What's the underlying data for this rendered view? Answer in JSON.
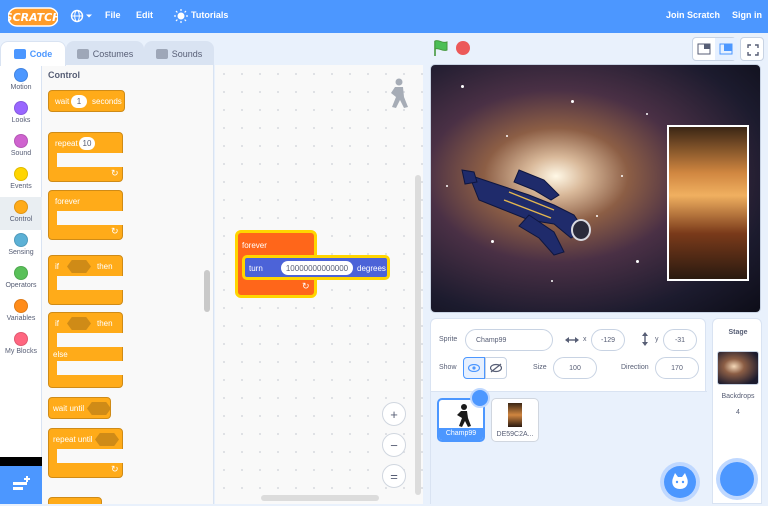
{
  "menubar": {
    "logo_text": "SCRATCH",
    "file": "File",
    "edit": "Edit",
    "tutorials": "Tutorials",
    "join": "Join Scratch",
    "signin": "Sign in"
  },
  "tabs": {
    "code": "Code",
    "costumes": "Costumes",
    "sounds": "Sounds"
  },
  "categories": [
    {
      "label": "Motion",
      "color": "#4c97ff"
    },
    {
      "label": "Looks",
      "color": "#9966ff"
    },
    {
      "label": "Sound",
      "color": "#cf63cf"
    },
    {
      "label": "Events",
      "color": "#ffd500"
    },
    {
      "label": "Control",
      "color": "#ffab19"
    },
    {
      "label": "Sensing",
      "color": "#5cb1d6"
    },
    {
      "label": "Operators",
      "color": "#59c059"
    },
    {
      "label": "Variables",
      "color": "#ff8c1a"
    },
    {
      "label": "My Blocks",
      "color": "#ff6680"
    }
  ],
  "palette": {
    "title": "Control",
    "wait": {
      "label": "wait",
      "value": "1",
      "unit": "seconds"
    },
    "repeat": {
      "label": "repeat",
      "value": "10"
    },
    "forever": "forever",
    "if_then": {
      "if": "if",
      "then": "then"
    },
    "if_else": {
      "if": "if",
      "then": "then",
      "else": "else"
    },
    "wait_until": "wait until",
    "repeat_until": "repeat until"
  },
  "script": {
    "forever": "forever",
    "turn": "turn",
    "turn_value": "10000000000000",
    "degrees": "degrees"
  },
  "zoom": {
    "in": "+",
    "out": "−",
    "reset": "="
  },
  "sprite_info": {
    "sprite_label": "Sprite",
    "sprite_name": "Champ99",
    "x_label": "x",
    "x_value": "-129",
    "y_label": "y",
    "y_value": "-31",
    "show_label": "Show",
    "size_label": "Size",
    "size_value": "100",
    "direction_label": "Direction",
    "direction_value": "170"
  },
  "sprites": [
    {
      "name": "Champ99",
      "selected": true
    },
    {
      "name": "DE59C2A...",
      "selected": false
    }
  ],
  "stage_panel": {
    "title": "Stage",
    "backdrops_label": "Backdrops",
    "backdrops_count": "4"
  }
}
